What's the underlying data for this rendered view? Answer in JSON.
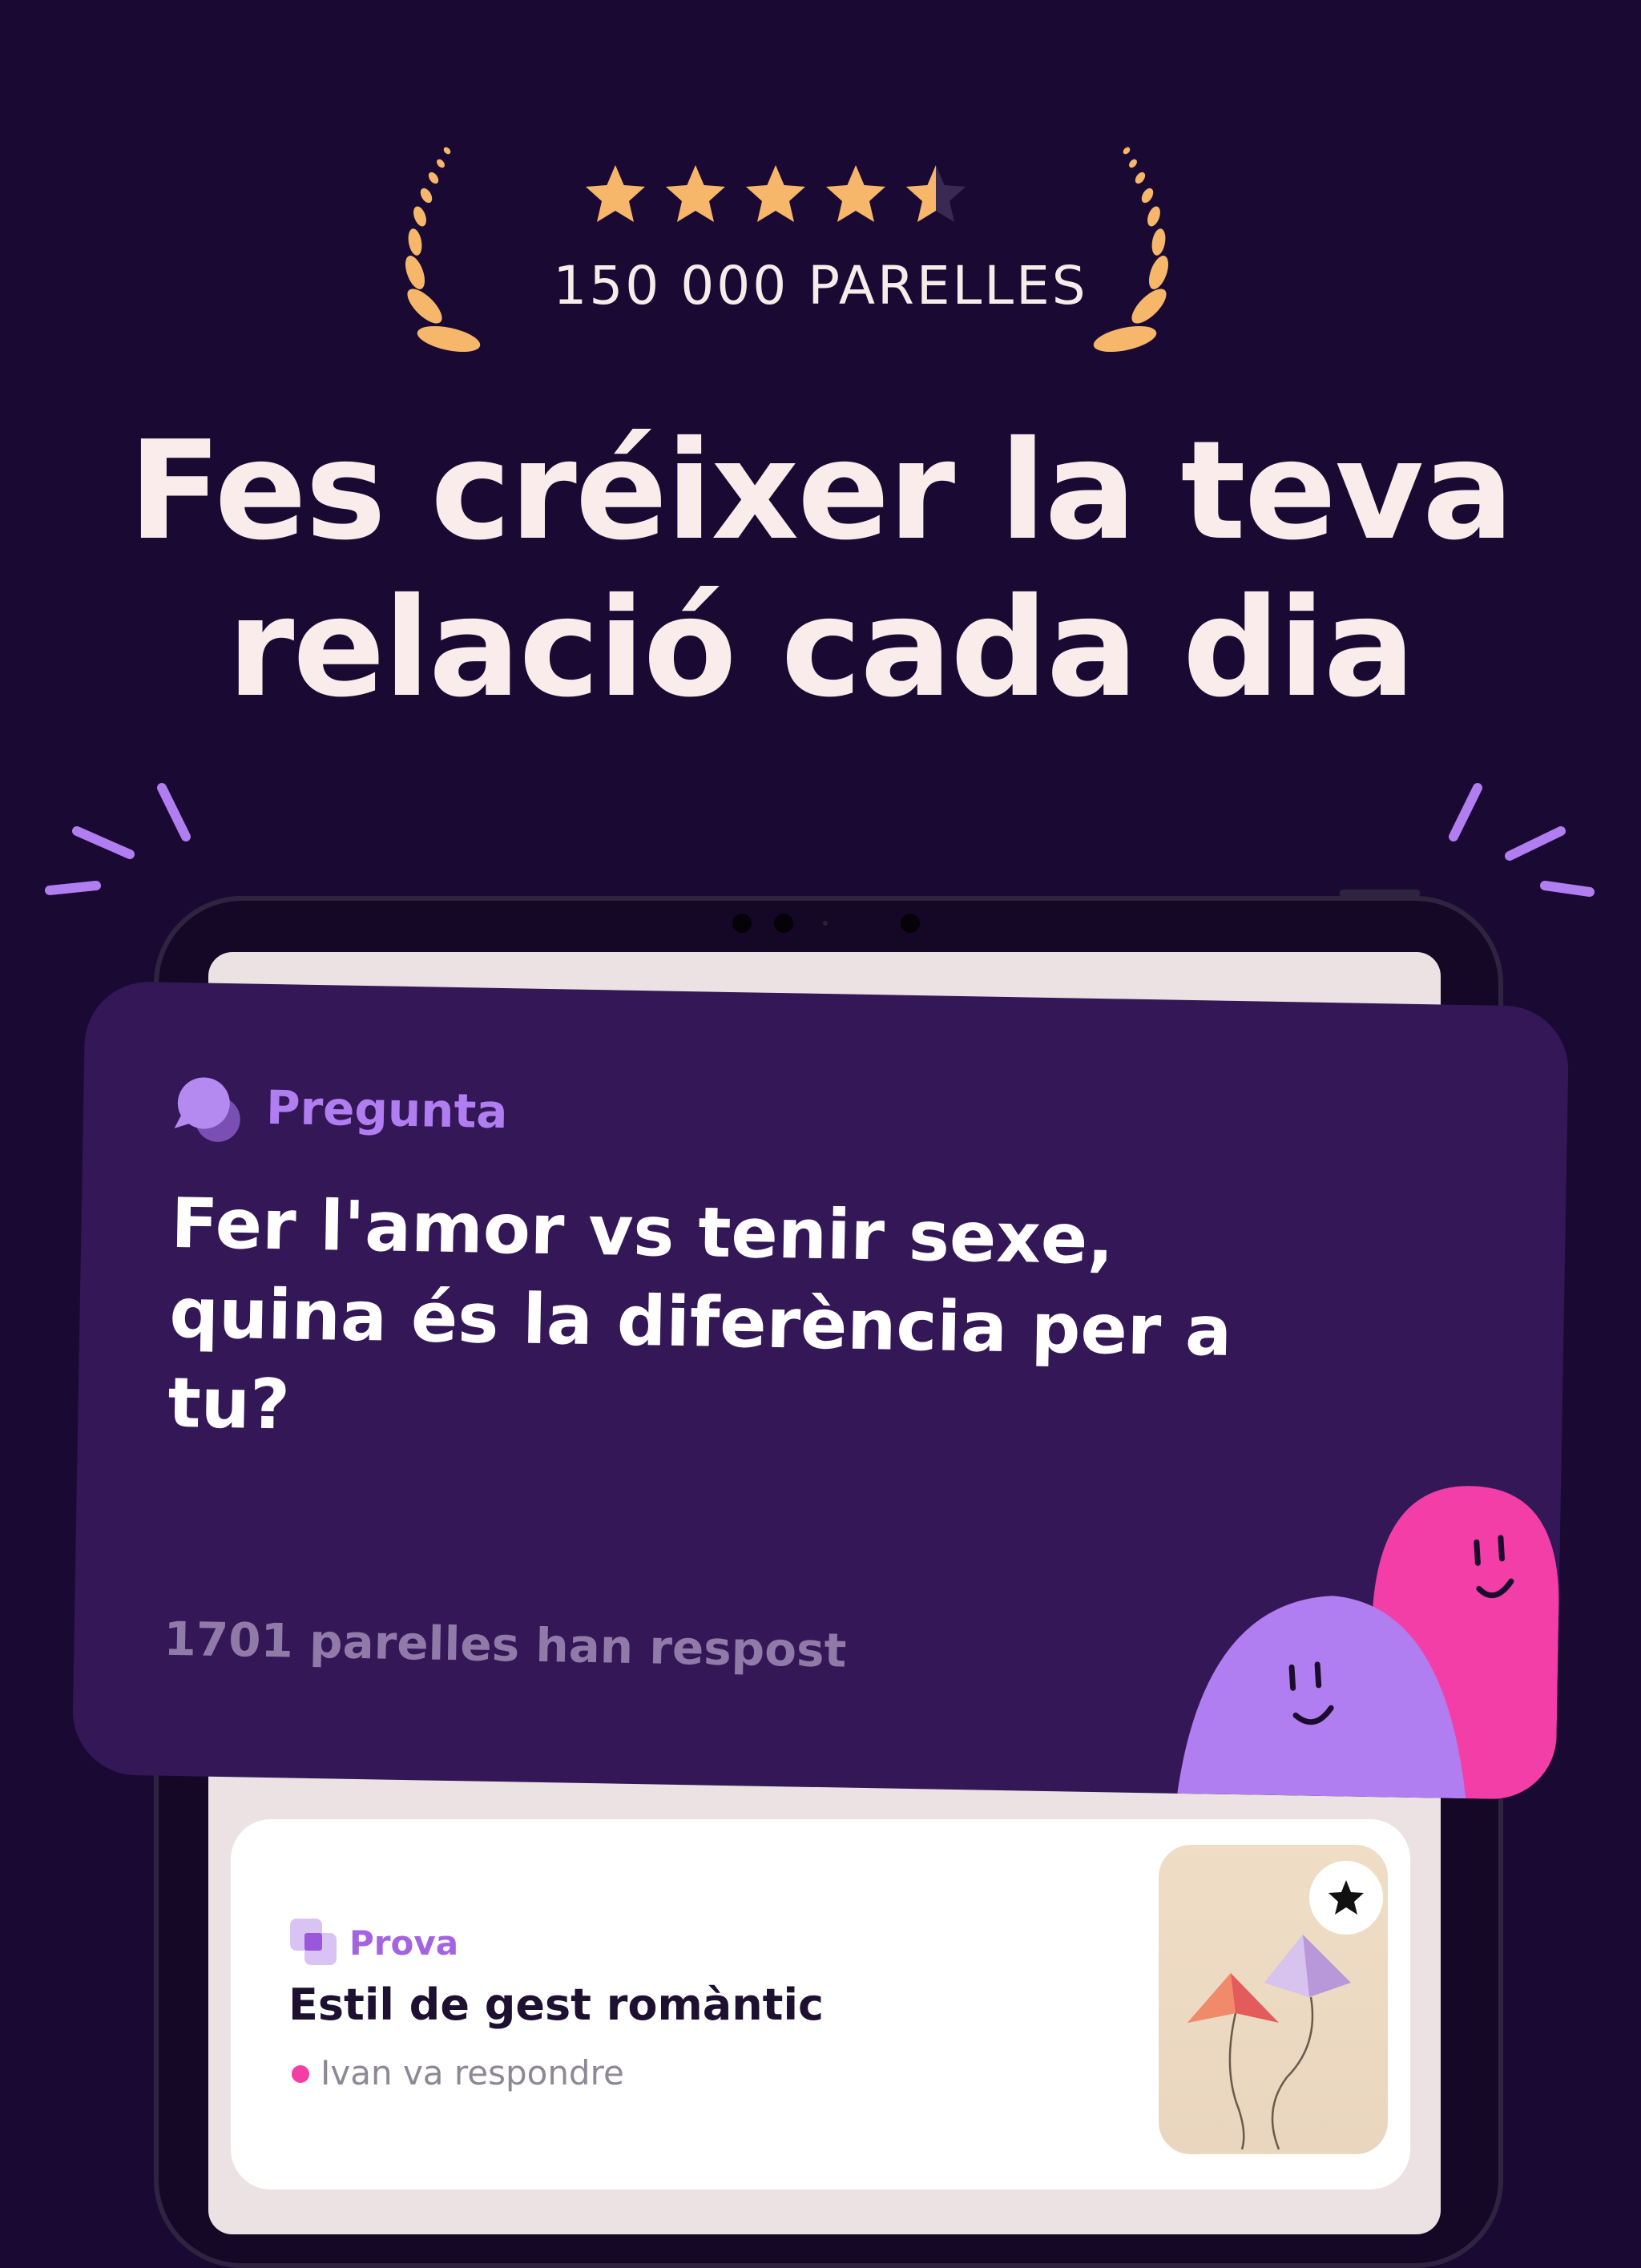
{
  "rating": {
    "stars": 4.5,
    "count_label": "150 000 PARELLES"
  },
  "headline": {
    "line1": "Fes créixer la teva",
    "line2": "relació cada dia"
  },
  "question_card": {
    "label": "Pregunta",
    "text": "Fer l'amor vs tenir sexe, quina és la diferència per a tu?",
    "answered": "1701 parelles han respost"
  },
  "prova_card": {
    "label": "Prova",
    "title": "Estil de gest romàntic",
    "status": "Ivan va respondre"
  },
  "colors": {
    "background": "#1a0a33",
    "card": "#341757",
    "accent_purple": "#b07ef0",
    "accent_pink": "#f23ea6",
    "star_gold": "#f6b76a"
  },
  "icons": [
    "laurel-left-icon",
    "laurel-right-icon",
    "star-icon",
    "chat-bubbles-icon",
    "prova-squares-icon",
    "favorite-star-icon",
    "kites-illustration"
  ]
}
